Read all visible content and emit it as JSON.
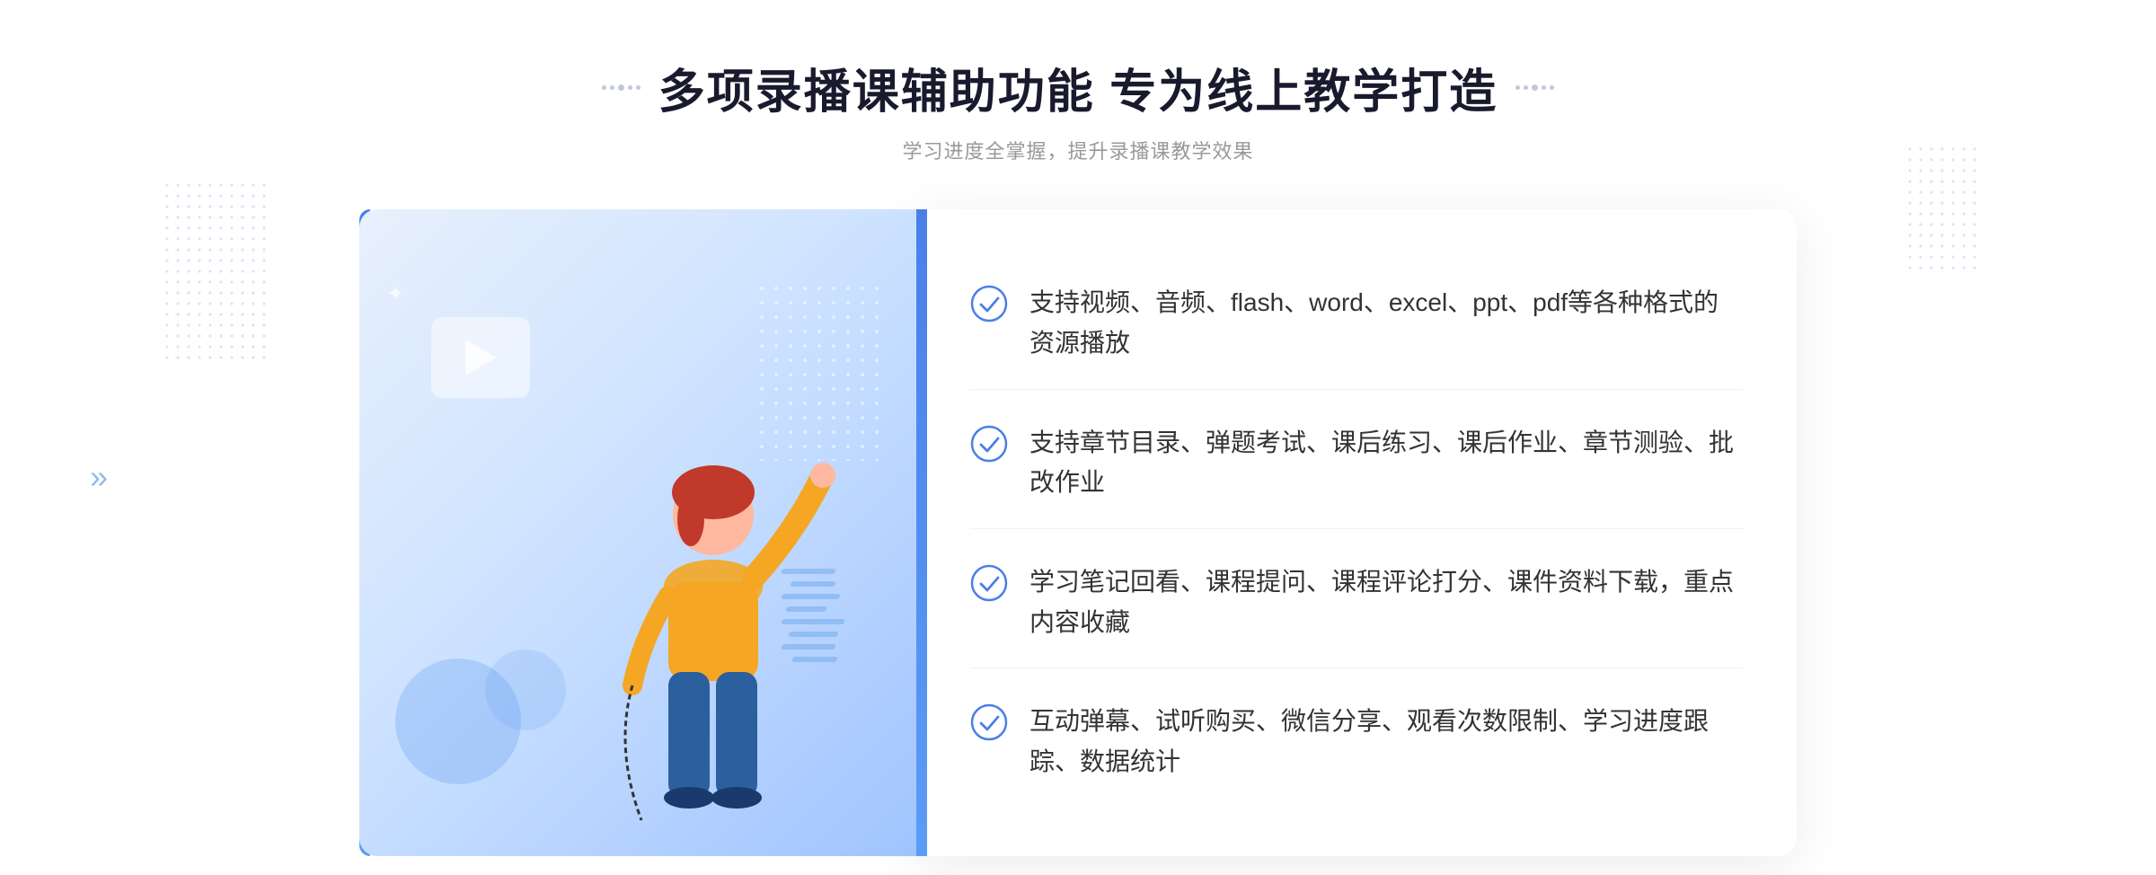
{
  "page": {
    "title": "多项录播课辅助功能 专为线上教学打造",
    "subtitle": "学习进度全掌握，提升录播课教学效果",
    "features": [
      {
        "id": "feature-1",
        "text": "支持视频、音频、flash、word、excel、ppt、pdf等各种格式的资源播放"
      },
      {
        "id": "feature-2",
        "text": "支持章节目录、弹题考试、课后练习、课后作业、章节测验、批改作业"
      },
      {
        "id": "feature-3",
        "text": "学习笔记回看、课程提问、课程评论打分、课件资料下载，重点内容收藏"
      },
      {
        "id": "feature-4",
        "text": "互动弹幕、试听购买、微信分享、观看次数限制、学习进度跟踪、数据统计"
      }
    ],
    "colors": {
      "accent_blue": "#4a7fe8",
      "light_blue": "#5b9cf6",
      "title_dark": "#1a1a2e",
      "text_normal": "#333333",
      "subtitle_gray": "#999999"
    },
    "icons": {
      "check_circle": "✓",
      "play": "▶",
      "chevron": "»",
      "sparkle": "✦"
    }
  }
}
